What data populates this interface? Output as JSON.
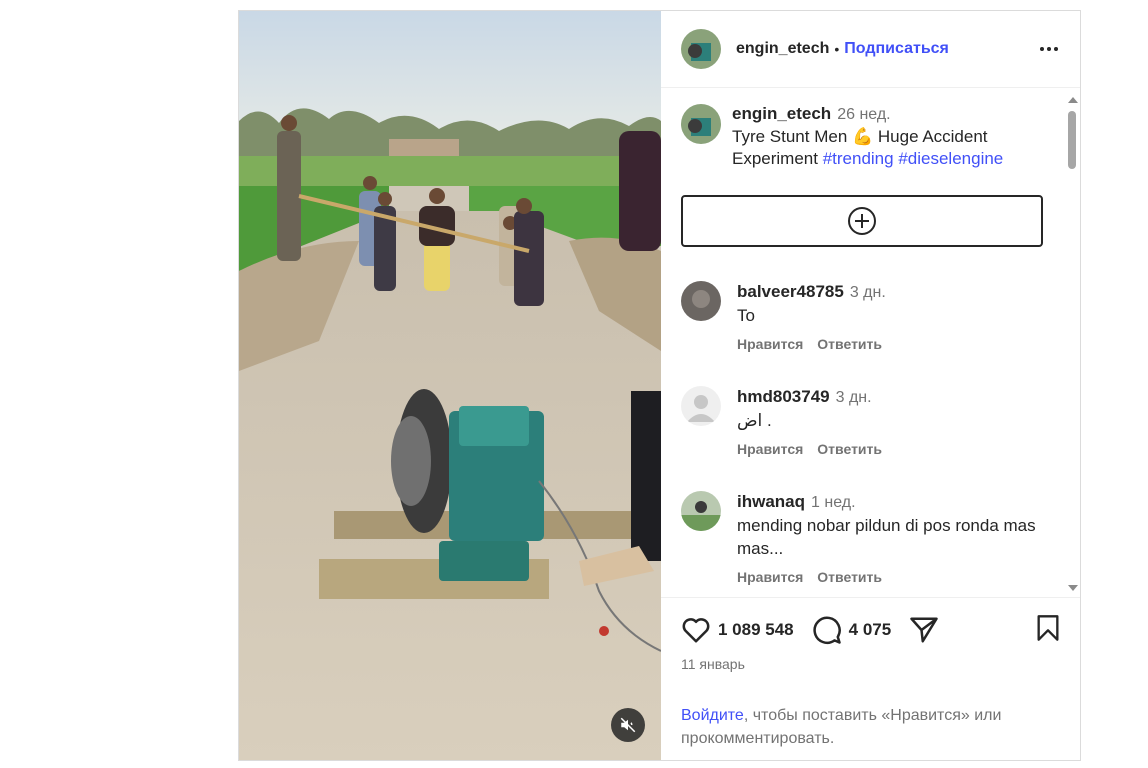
{
  "post": {
    "username": "engin_etech",
    "dot": "•",
    "follow_label": "Подписаться",
    "caption": {
      "username": "engin_etech",
      "time": "26 нед.",
      "text_part1": "Tyre Stunt Men ",
      "emoji": "💪",
      "text_part2": " Huge Accident Experiment ",
      "hashtags": [
        "#trending",
        "#dieselengine"
      ]
    },
    "comments": [
      {
        "username": "balveer48785",
        "time": "3 дн.",
        "text": "To",
        "like_label": "Нравится",
        "reply_label": "Ответить"
      },
      {
        "username": "hmd803749",
        "time": "3 дн.",
        "text": "اض .",
        "like_label": "Нравится",
        "reply_label": "Ответить"
      },
      {
        "username": "ihwanaq",
        "time": "1 нед.",
        "text": "mending nobar pildun di pos ronda mas mas...",
        "like_label": "Нравится",
        "reply_label": "Ответить"
      }
    ],
    "likes_count": "1 089 548",
    "comments_count": "4 075",
    "date": "11 январь",
    "login_link": "Войдите",
    "login_rest": ", чтобы поставить «Нравится» или прокомментировать.",
    "icons": [
      "more-icon",
      "add-comment-icon",
      "heart-icon",
      "comment-icon",
      "share-icon",
      "bookmark-icon",
      "mute-icon"
    ],
    "colors": {
      "link": "#4150f7",
      "muted": "#737373",
      "text": "#262626",
      "border": "#dbdbdb"
    }
  }
}
